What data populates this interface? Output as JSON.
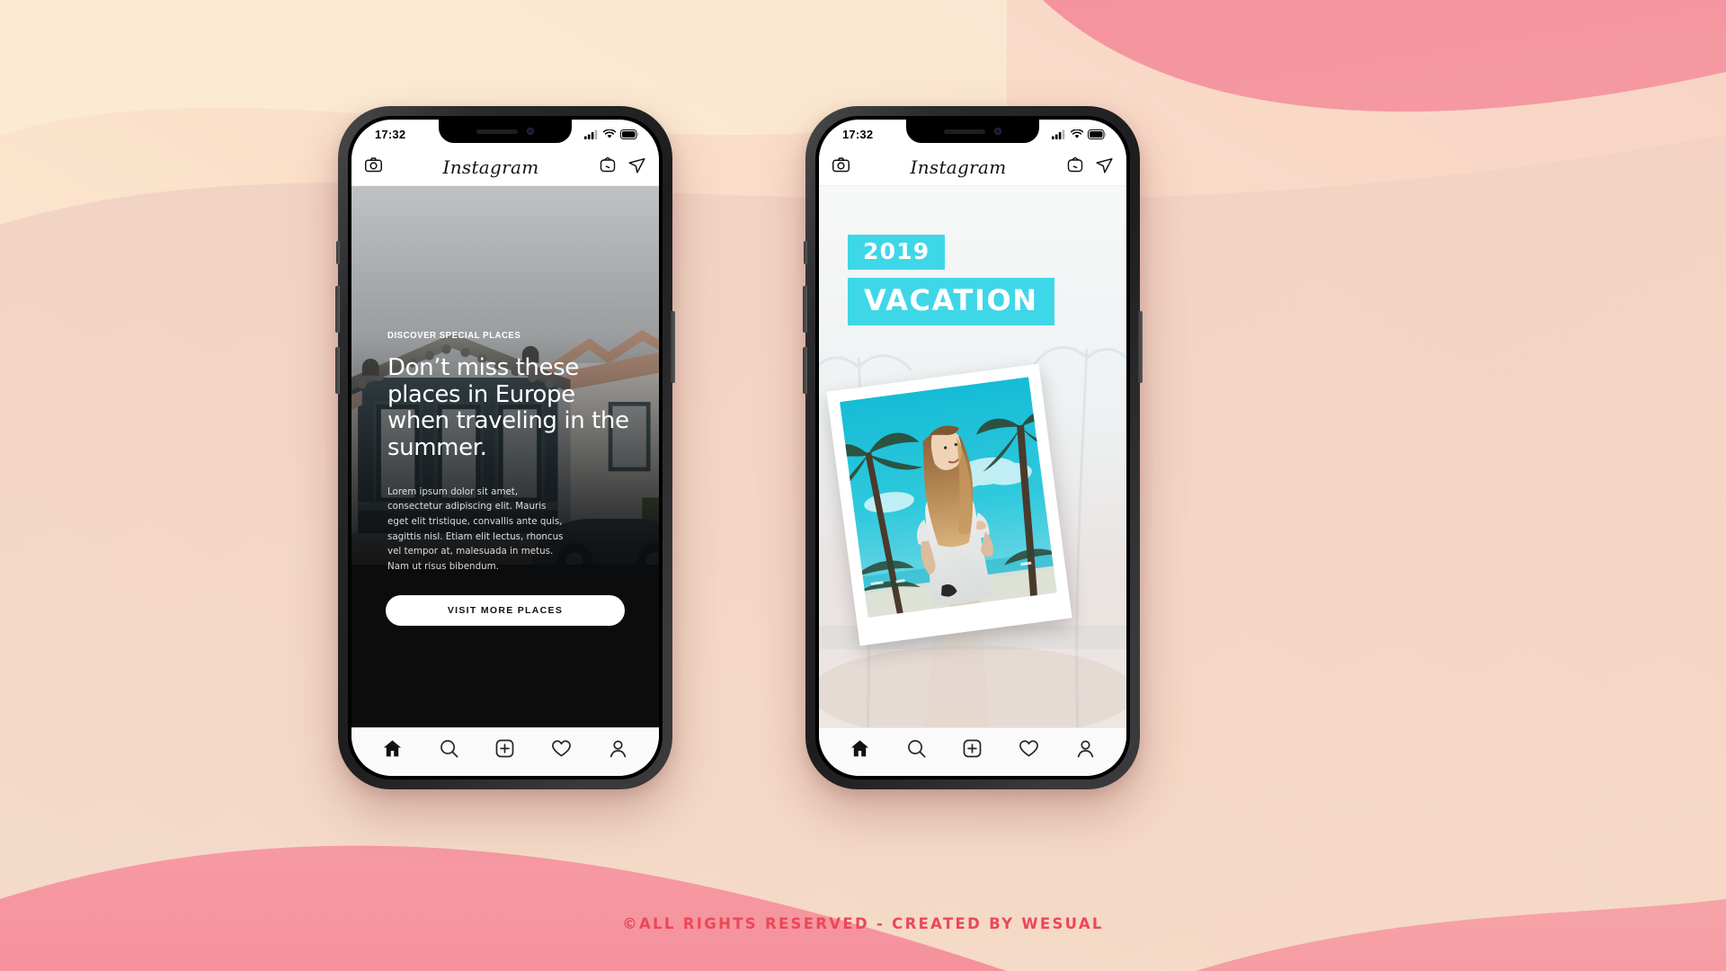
{
  "background": {
    "base_color": "#FBE3CC",
    "cream": "#FDF0D5",
    "peach": "#F8D6BE",
    "pink": "#F2919C",
    "blush": "#EFC9BE"
  },
  "footer": {
    "credit": "©ALL RIGHTS RESERVED - CREATED BY WESUAL",
    "color": "#EC4758"
  },
  "phones": [
    {
      "name": "left",
      "status_bar": {
        "time": "17:32",
        "signal_icon": "cellular-signal-icon",
        "wifi_icon": "wifi-icon",
        "battery_icon": "battery-icon"
      },
      "app_header": {
        "camera_icon": "camera-icon",
        "logo": "Instagram",
        "igtv_icon": "igtv-icon",
        "direct_icon": "send-paper-plane-icon"
      },
      "post": {
        "type": "travel-promo",
        "eyebrow": "DISCOVER SPECIAL PLACES",
        "headline": "Don’t miss these places in Europe when traveling in the summer.",
        "body": "Lorem ipsum dolor sit amet, consectetur adipiscing elit. Mauris eget elit tristique, convallis ante quis, sagittis nisl. Etiam elit lectus, rhoncus vel tempor at, malesuada in metus. Nam ut risus bibendum.",
        "cta_label": "VISIT MORE PLACES",
        "photo_description": "Mediterranean village rooftops with teal building facade and parked car"
      },
      "bottom_nav": [
        {
          "label": "Home",
          "icon": "home-icon",
          "active": true
        },
        {
          "label": "Search",
          "icon": "search-icon",
          "active": false
        },
        {
          "label": "Create",
          "icon": "plus-square-icon",
          "active": false
        },
        {
          "label": "Activity",
          "icon": "heart-icon",
          "active": false
        },
        {
          "label": "Profile",
          "icon": "person-icon",
          "active": false
        }
      ]
    },
    {
      "name": "right",
      "status_bar": {
        "time": "17:32",
        "signal_icon": "cellular-signal-icon",
        "wifi_icon": "wifi-icon",
        "battery_icon": "battery-icon"
      },
      "app_header": {
        "camera_icon": "camera-icon",
        "logo": "Instagram",
        "igtv_icon": "igtv-icon",
        "direct_icon": "send-paper-plane-icon"
      },
      "post": {
        "type": "vacation-promo",
        "tag_year": "2019",
        "tag_word": "VACATION",
        "accent_color": "#3ED7E8",
        "photo_description": "Woman in white shirt standing between palm trees on a tropical beach, polaroid frame rotated",
        "frame_rotation_deg": -7.5
      },
      "bottom_nav": [
        {
          "label": "Home",
          "icon": "home-icon",
          "active": true
        },
        {
          "label": "Search",
          "icon": "search-icon",
          "active": false
        },
        {
          "label": "Create",
          "icon": "plus-square-icon",
          "active": false
        },
        {
          "label": "Activity",
          "icon": "heart-icon",
          "active": false
        },
        {
          "label": "Profile",
          "icon": "person-icon",
          "active": false
        }
      ]
    }
  ]
}
